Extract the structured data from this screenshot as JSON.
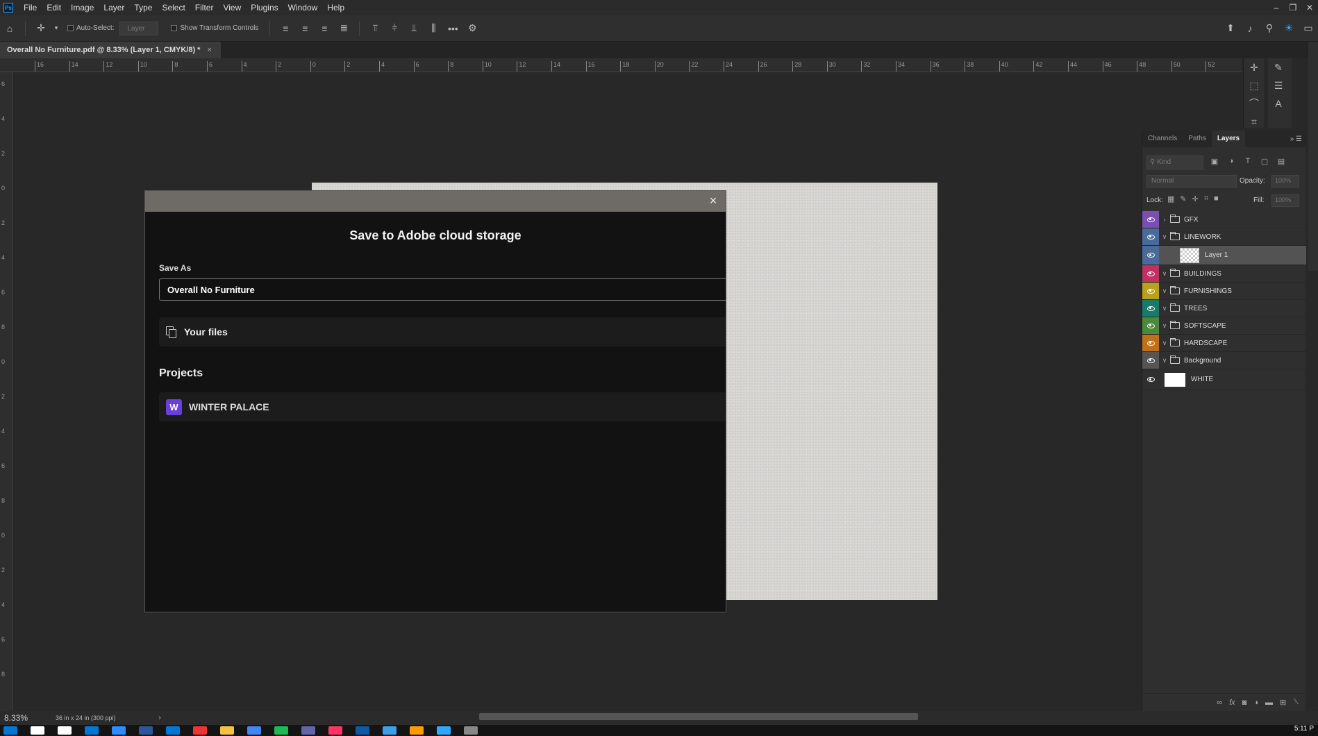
{
  "app": {
    "logo": "Ps",
    "accent": "#31a8ff"
  },
  "menu": [
    "File",
    "Edit",
    "Image",
    "Layer",
    "Type",
    "Select",
    "Filter",
    "View",
    "Plugins",
    "Window",
    "Help"
  ],
  "window_controls": [
    "minimize-icon",
    "restore-icon",
    "close-icon"
  ],
  "options_bar": {
    "auto_select_label": "Auto-Select:",
    "layer_dropdown": "Layer",
    "show_transform_label": "Show Transform Controls"
  },
  "doc_tab": {
    "title": "Overall No Furniture.pdf @ 8.33% (Layer 1, CMYK/8) *",
    "close": "×"
  },
  "ruler_h": [
    "16",
    "14",
    "12",
    "10",
    "8",
    "6",
    "4",
    "2",
    "0",
    "2",
    "4",
    "6",
    "8",
    "10",
    "12",
    "14",
    "16",
    "18",
    "20",
    "22",
    "24",
    "26",
    "28",
    "30",
    "32",
    "34",
    "36",
    "38",
    "40",
    "42",
    "44",
    "46",
    "48",
    "50",
    "52"
  ],
  "ruler_v": [
    "6",
    "4",
    "2",
    "0",
    "2",
    "4",
    "6",
    "8",
    "0",
    "2",
    "4",
    "6",
    "8",
    "0",
    "2",
    "4",
    "6",
    "8"
  ],
  "dialog": {
    "title": "Save to Adobe cloud storage",
    "close": "×",
    "save_as_label": "Save As",
    "save_as_value": "Overall No Furniture",
    "your_files_label": "Your files",
    "projects_label": "Projects",
    "project_badge": "W",
    "project_name": "WINTER PALACE",
    "badge_color": "#6a3ed9"
  },
  "layers_panel": {
    "tabs": [
      "Channels",
      "Paths",
      "Layers"
    ],
    "active_tab": "Layers",
    "kind_placeholder": "Kind",
    "blend_mode": "Normal",
    "opacity_label": "Opacity:",
    "opacity_value": "100%",
    "lock_label": "Lock:",
    "fill_label": "Fill:",
    "fill_value": "100%",
    "layers": [
      {
        "name": "GFX",
        "color": "#7a4fb0",
        "type": "group",
        "expanded": false
      },
      {
        "name": "LINEWORK",
        "color": "#4a6a9a",
        "type": "group",
        "expanded": true
      },
      {
        "name": "Layer 1",
        "color": "#4a6a9a",
        "type": "layer",
        "selected": true
      },
      {
        "name": "BUILDINGS",
        "color": "#c03060",
        "type": "group",
        "expanded": true
      },
      {
        "name": "FURNISHINGS",
        "color": "#b8a020",
        "type": "group",
        "expanded": true
      },
      {
        "name": "TREES",
        "color": "#1a7a6a",
        "type": "group",
        "expanded": true
      },
      {
        "name": "SOFTSCAPE",
        "color": "#4a8a3a",
        "type": "group",
        "expanded": true
      },
      {
        "name": "HARDSCAPE",
        "color": "#c0701a",
        "type": "group",
        "expanded": true
      },
      {
        "name": "Background",
        "color": "#555555",
        "type": "group",
        "expanded": true
      },
      {
        "name": "WHITE",
        "color": "#2f2f2f",
        "type": "fill"
      }
    ]
  },
  "status": {
    "zoom": "8.33%",
    "doc_info": "36 in x 24 in (300 ppi)",
    "arrow": "›"
  },
  "taskbar": {
    "icons": [
      "windows-icon",
      "search-icon",
      "task-view-icon",
      "store-icon",
      "zoom-icon",
      "word-icon",
      "outlook-icon",
      "acrobat-icon",
      "explorer-icon",
      "chrome-icon",
      "spotify-icon",
      "teams-icon",
      "indesign-icon",
      "edge-icon",
      "app-icon",
      "illustrator-icon",
      "photoshop-icon",
      "bridge-icon"
    ],
    "icon_colors": [
      "#0078d4",
      "#ffffff",
      "#ffffff",
      "#0078d4",
      "#2d8cff",
      "#2b579a",
      "#0078d4",
      "#e33",
      "#f5c242",
      "#4285f4",
      "#1db954",
      "#6264a7",
      "#ff3366",
      "#0c59a4",
      "#3aa0e8",
      "#ff9a00",
      "#31a8ff",
      "#888"
    ],
    "clock": "5:11 P"
  }
}
